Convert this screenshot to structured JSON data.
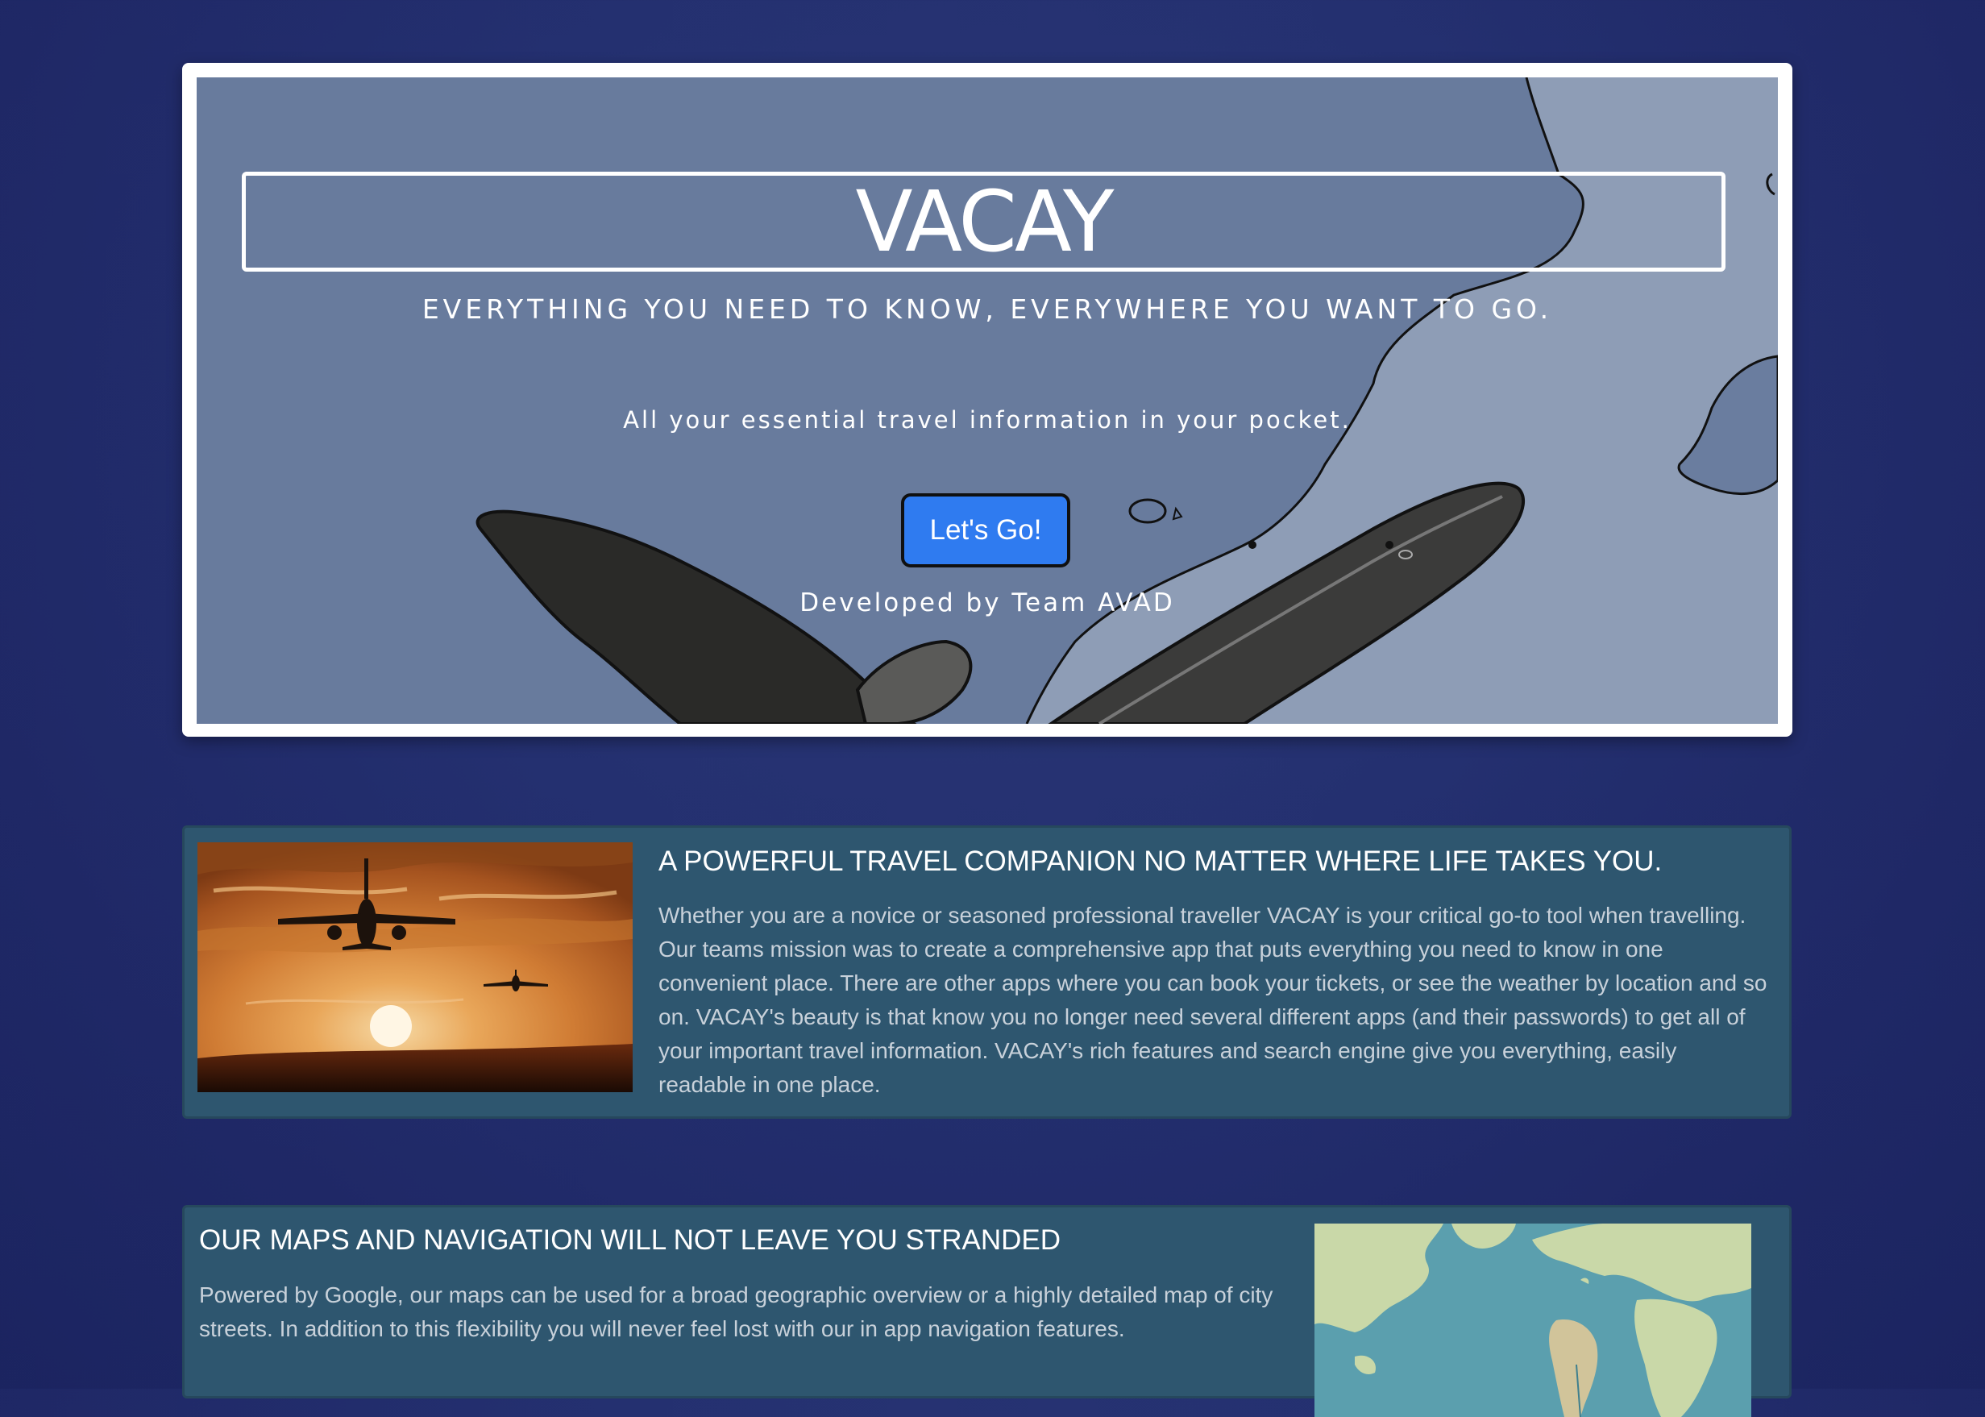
{
  "hero": {
    "title": "VACAY",
    "tagline": "EVERYTHING YOU NEED TO KNOW, EVERYWHERE YOU WANT TO GO.",
    "subtitle": "All your essential travel information in your pocket.",
    "button_label": "Let's Go!",
    "credit": "Developed by Team AVAD"
  },
  "features": [
    {
      "title": "A POWERFUL TRAVEL COMPANION NO MATTER WHERE LIFE TAKES YOU.",
      "body": "Whether you are a novice or seasoned professional traveller VACAY is your critical go-to tool when travelling. Our teams mission was to create a comprehensive app that puts everything you need to know in one convenient place. There are other apps where you can book your tickets, or see the weather by location and so on. VACAY's beauty is that know you no longer need several different apps (and their passwords) to get all of your important travel information. VACAY's rich features and search engine give you everything, easily readable in one place."
    },
    {
      "title": "OUR MAPS AND NAVIGATION WILL NOT LEAVE YOU STRANDED",
      "body": "Powered by Google, our maps can be used for a broad geographic overview or a highly detailed map of city streets. In addition to this flexibility you will never feel lost with our in app navigation features."
    }
  ],
  "colors": {
    "page_background": "#232d6c",
    "hero_background": "#687b9d",
    "button": "#2f7bf0",
    "card_background": "#2e566f"
  }
}
